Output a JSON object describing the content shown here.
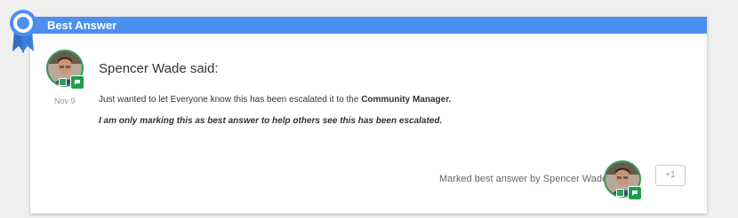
{
  "header": {
    "title": "Best Answer",
    "color": "#4b8ff0"
  },
  "post": {
    "author_said": "Spencer Wade said:",
    "date": "Nov 9",
    "body_line1_prefix": "Just wanted to let Everyone know this has been escalated it to the ",
    "body_line1_bold": "Community Manager.",
    "body_line2": "I am only marking this as best answer to help others see this has been escalated."
  },
  "footer": {
    "marked_text": "Marked best answer by Spencer Wade",
    "plus_one_label": "+1"
  },
  "icons": {
    "ribbon": "best-answer-ribbon-icon",
    "badge": "community-badge-icon"
  },
  "colors": {
    "badge_green": "#1e9e4a",
    "ribbon_blue": "#4b8ff0"
  }
}
